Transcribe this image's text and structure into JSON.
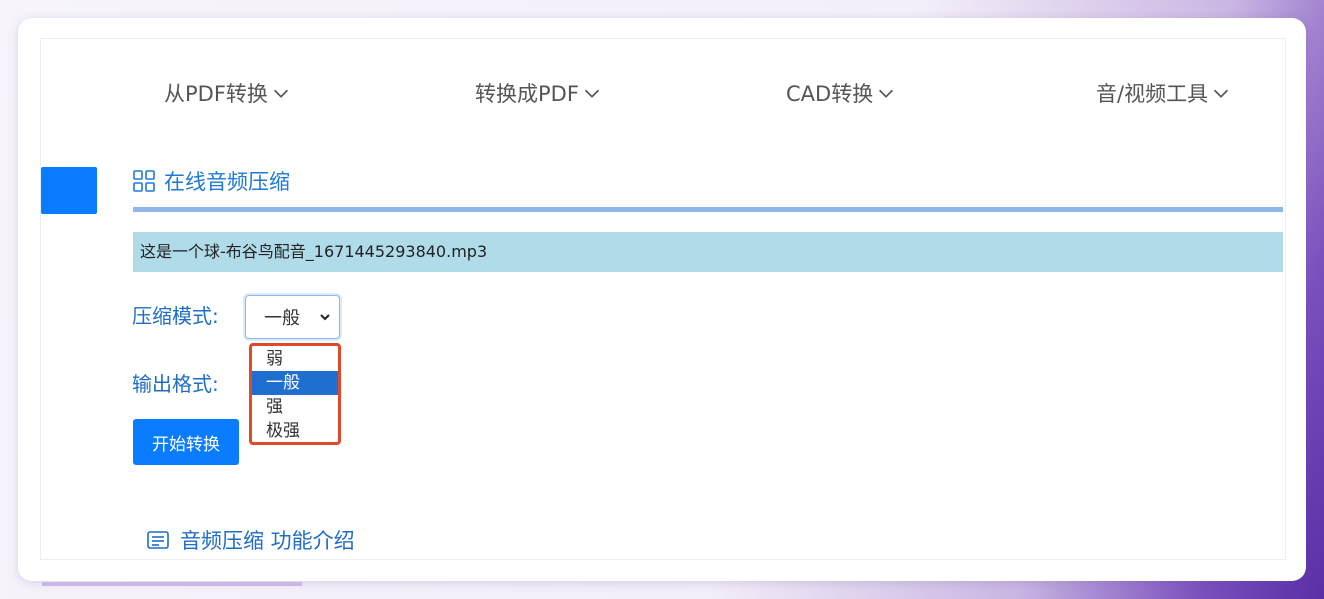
{
  "nav": {
    "items": [
      {
        "label": "从PDF转换"
      },
      {
        "label": "转换成PDF"
      },
      {
        "label": "CAD转换"
      },
      {
        "label": "音/视频工具"
      }
    ]
  },
  "section": {
    "title": "在线音频压缩",
    "file_name": "这是一个球-布谷鸟配音_1671445293840.mp3"
  },
  "form": {
    "mode_label": "压缩模式:",
    "format_label": "输出格式:",
    "mode_selected": "一般",
    "mode_options": [
      "弱",
      "一般",
      "强",
      "极强"
    ],
    "start_button": "开始转换"
  },
  "intro": {
    "title": "音频压缩 功能介绍"
  },
  "colors": {
    "accent": "#0a7cff",
    "label_text": "#1f6ec4",
    "file_bar": "#b0dbe9",
    "highlight_border": "#e04a2a",
    "selected_option": "#1f6fd1"
  },
  "icons": {
    "nav_chevron": "chevron-down-icon",
    "section": "grid-icon",
    "intro": "document-icon",
    "select_caret": "caret-down-icon"
  }
}
